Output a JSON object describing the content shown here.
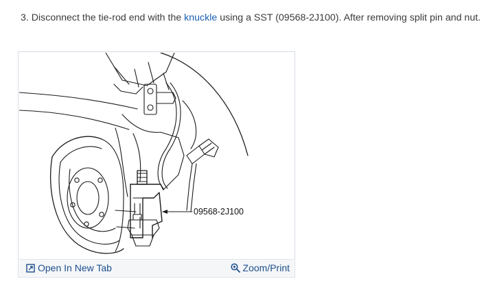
{
  "step": {
    "prefix": "3. Disconnect the tie-rod end with the ",
    "link_text": "knuckle",
    "suffix": " using a SST (09568-2J100). After removing split pin and nut."
  },
  "figure": {
    "callout_label": "09568-2J100"
  },
  "footer": {
    "open_tab_label": "Open In New Tab",
    "zoom_label": "Zoom/Print"
  },
  "colors": {
    "link": "#1a5fb4",
    "footer_link": "#1e4e8c",
    "footer_bg": "#f4f6f8"
  },
  "icons": [
    "open-new-tab-icon",
    "magnifier-plus-icon"
  ]
}
